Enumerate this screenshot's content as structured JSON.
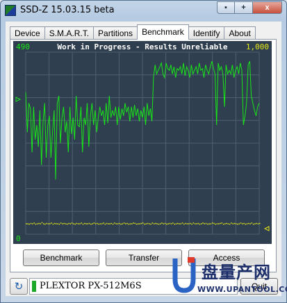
{
  "window": {
    "title": "SSD-Z 15.03.15 beta",
    "buttons": {
      "minimize": "▪",
      "maximize": "+",
      "close": "x"
    }
  },
  "tabs": [
    {
      "label": "Device",
      "active": false
    },
    {
      "label": "S.M.A.R.T.",
      "active": false
    },
    {
      "label": "Partitions",
      "active": false
    },
    {
      "label": "Benchmark",
      "active": true
    },
    {
      "label": "Identify",
      "active": false
    },
    {
      "label": "About",
      "active": false
    }
  ],
  "chart_data": {
    "type": "line",
    "title": "Work in Progress - Results Unreliable",
    "left_axis_max": "490",
    "left_axis_min": "0",
    "right_axis_max": "1,000",
    "ylim": [
      0,
      1000
    ],
    "grid": true,
    "colors": {
      "background": "#2f3f4f",
      "grid": "#4e6172",
      "primary": "#19e619",
      "secondary": "#e6e619"
    },
    "series": [
      {
        "values": [
          780,
          560,
          720,
          690,
          450,
          700,
          520,
          600,
          480,
          680,
          380,
          620,
          720,
          420,
          600,
          650,
          420,
          560,
          680,
          300,
          720,
          760,
          500,
          640,
          700,
          560,
          620,
          450,
          700,
          550,
          640,
          520,
          760,
          600,
          590,
          700,
          450,
          640,
          600,
          720,
          480,
          650,
          720,
          600,
          680,
          560,
          640,
          700,
          650,
          680,
          600,
          720,
          610,
          760,
          640,
          680,
          650,
          700,
          600,
          700,
          630,
          690,
          650,
          720,
          670,
          700,
          620,
          700,
          640,
          710,
          650,
          690,
          620,
          680,
          640,
          700,
          600,
          720,
          650,
          690,
          620,
          860,
          930,
          880,
          900,
          920,
          940,
          880,
          860,
          940,
          910,
          900,
          930,
          880,
          920,
          860,
          910,
          900,
          920,
          880,
          940,
          870,
          920,
          900,
          860,
          930,
          880,
          900,
          920,
          880,
          940,
          900,
          910,
          860,
          930,
          900,
          880,
          920,
          950,
          910,
          880,
          600,
          940,
          900,
          920,
          880,
          700,
          930,
          880,
          900,
          880,
          930,
          860,
          900,
          920,
          880,
          940,
          900,
          600,
          650,
          720,
          930,
          950,
          760,
          720,
          680,
          650,
          700,
          720
        ]
      },
      {
        "values": [
          60,
          60,
          58,
          62,
          60,
          64,
          58,
          60,
          62,
          60,
          66,
          60,
          58,
          62,
          60,
          60,
          64,
          58,
          62,
          60,
          60,
          58,
          64,
          60,
          62,
          60,
          58,
          62,
          60,
          64,
          60,
          58,
          62,
          60,
          60,
          64,
          58,
          62,
          60,
          60,
          62,
          58,
          60,
          64,
          60,
          62,
          58,
          60,
          60,
          64,
          58,
          62,
          60,
          60,
          62,
          58,
          64,
          60,
          60,
          62,
          58,
          60,
          64,
          60,
          62,
          58,
          60,
          60,
          64,
          62,
          58,
          60,
          60,
          62,
          64,
          58,
          60,
          62,
          60,
          58,
          64,
          60,
          62,
          60,
          58,
          60,
          64,
          60,
          62,
          58,
          60,
          62,
          60,
          64,
          58,
          60,
          62,
          60,
          60,
          64,
          58,
          62,
          60,
          60,
          62,
          58,
          64,
          60,
          60,
          62,
          58,
          60,
          64,
          60,
          62,
          58,
          60,
          60,
          64,
          62,
          58,
          60,
          60,
          62,
          64,
          58,
          60,
          62,
          60,
          58,
          64,
          60,
          62,
          60,
          58,
          60,
          64,
          60,
          62,
          58,
          60,
          62,
          60,
          64,
          58,
          60,
          62,
          60,
          62
        ]
      }
    ]
  },
  "buttons": {
    "benchmark": "Benchmark",
    "transfer": "Transfer",
    "access": "Access",
    "quit": "Quit"
  },
  "status": {
    "refresh_icon": "↻",
    "drive_name": "PLEXTOR PX-512M6S"
  },
  "watermark": {
    "text_cn": "盘量产网",
    "url": "WWW.UPANTOOL.COM"
  }
}
